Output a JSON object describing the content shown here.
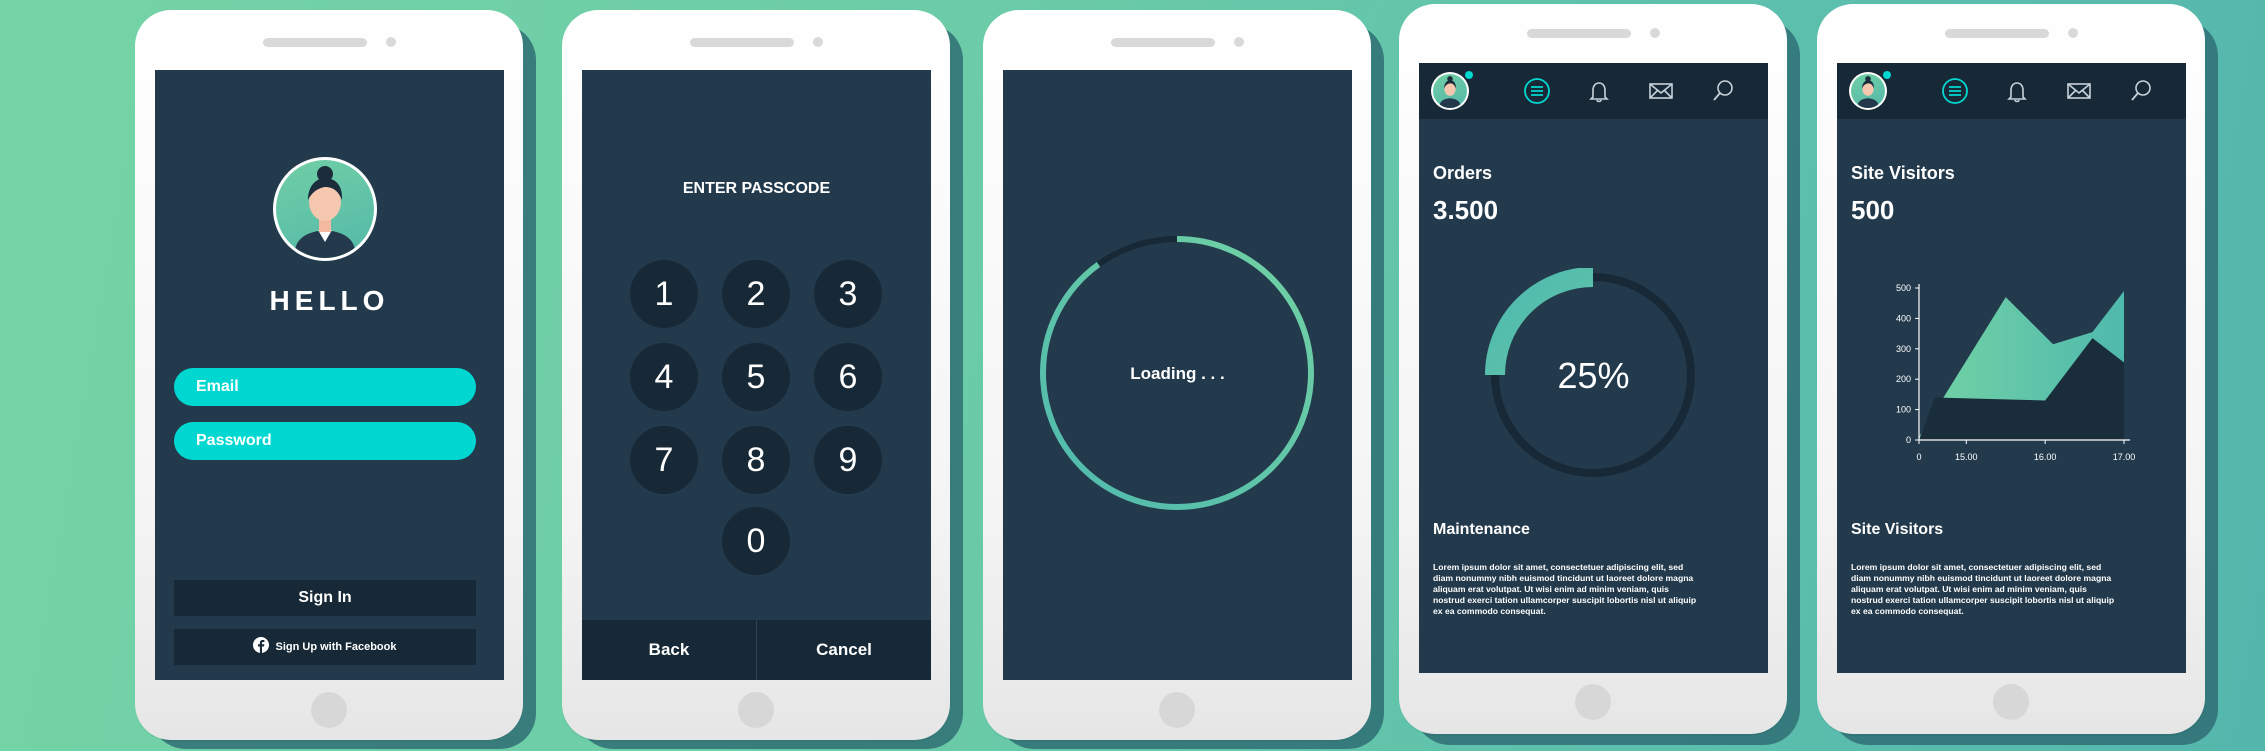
{
  "login": {
    "greeting": "HELLO",
    "email_placeholder": "Email",
    "password_placeholder": "Password",
    "sign_in_label": "Sign In",
    "facebook_label": "Sign Up with Facebook"
  },
  "passcode": {
    "title": "ENTER PASSCODE",
    "keys": [
      "1",
      "2",
      "3",
      "4",
      "5",
      "6",
      "7",
      "8",
      "9",
      "0"
    ],
    "back_label": "Back",
    "cancel_label": "Cancel"
  },
  "loading": {
    "text": "Loading . . .",
    "progress_fraction": 0.9
  },
  "orders": {
    "title": "Orders",
    "value": "3.500",
    "percent_text": "25%",
    "progress_fraction": 0.25,
    "section_title": "Maintenance",
    "body": "Lorem ipsum dolor sit amet, consectetuer adipiscing elit, sed diam nonummy nibh euismod tincidunt ut laoreet dolore magna aliquam erat volutpat. Ut wisi enim ad minim veniam, quis nostrud exerci tation ullamcorper suscipit lobortis nisl ut aliquip ex ea commodo consequat."
  },
  "visitors": {
    "title": "Site Visitors",
    "value": "500",
    "section_title": "Site Visitors",
    "body": "Lorem ipsum dolor sit amet, consectetuer adipiscing elit, sed diam nonummy nibh euismod tincidunt ut laoreet dolore magna aliquam erat volutpat. Ut wisi enim ad minim veniam, quis nostrud exerci tation ullamcorper suscipit lobortis nisl ut aliquip ex ea commodo consequat."
  },
  "icons": [
    "avatar",
    "menu-icon",
    "bell-icon",
    "mail-icon",
    "search-icon",
    "facebook-icon"
  ],
  "colors": {
    "screen_bg": "#233a4d",
    "dark_panel": "#172936",
    "accent_cyan": "#00d7d1",
    "accent_green": "#6fd0a4",
    "accent_teal": "#4fb9ad"
  },
  "chart_data": {
    "type": "area",
    "x": [
      0,
      15.0,
      16.0,
      17.0
    ],
    "x_tick_labels": [
      "0",
      "15.00",
      "16.00",
      "17.00"
    ],
    "y_tick_labels": [
      "0",
      "100",
      "200",
      "300",
      "400",
      "500"
    ],
    "ylim": [
      0,
      500
    ],
    "series": [
      {
        "values_at": [
          [
            0,
            10
          ],
          [
            15.5,
            470
          ],
          [
            16.1,
            315
          ],
          [
            16.6,
            355
          ],
          [
            17.0,
            490
          ]
        ]
      },
      {
        "values_at": [
          [
            0,
            0
          ],
          [
            14.6,
            140
          ],
          [
            16.0,
            130
          ],
          [
            16.6,
            335
          ],
          [
            17.0,
            255
          ]
        ]
      }
    ],
    "grid": false,
    "legend": "none"
  }
}
